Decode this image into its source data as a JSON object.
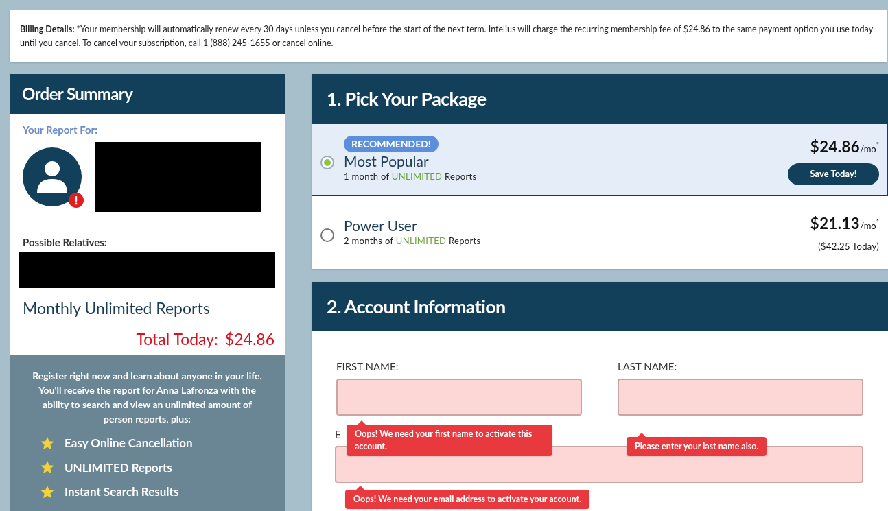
{
  "billing": {
    "text": "**Billing Details:** *Your membership will automatically renew every 30 days unless you cancel before the start of the next term. Intelius will charge the recurring membership fee of $24.86 to the same payment option you use today until you cancel. To cancel your subscription, call 1 (888) 245-1655 or cancel online."
  },
  "order_summary": {
    "title": "Order Summary",
    "report_for_label": "Your Report For:",
    "relatives_label": "Possible Relatives:",
    "plan": "Monthly Unlimited Reports",
    "total_label": "Total Today:",
    "total_value": "$24.86",
    "promo": "Register right now and learn about anyone in your life. You'll receive the report for Anna Lafronza with the ability to search and view an unlimited amount of person reports, plus:",
    "features": [
      "Easy Online Cancellation",
      "UNLIMITED Reports",
      "Instant Search Results"
    ]
  },
  "packages": {
    "title": "1. Pick Your Package",
    "items": [
      {
        "badge": "RECOMMENDED!",
        "name": "Most Popular",
        "description": "1 month of **UNLIMITED** Reports",
        "price": "$24.86",
        "unit": "/mo",
        "mark": "*",
        "button": "Save Today!",
        "selected": true
      },
      {
        "name": "Power User",
        "description": "2 months of **UNLIMITED** Reports",
        "price": "$21.13",
        "unit": "/mo",
        "mark": "*",
        "note": "($42.25 Today)",
        "selected": false
      }
    ]
  },
  "account": {
    "title": "2. Account Information",
    "fields": [
      {
        "label": "FIRST NAME:",
        "error": "Oops! We need your first name to activate this account."
      },
      {
        "label": "LAST NAME:",
        "error": "Please enter your last name also."
      },
      {
        "label": "E",
        "error": "Oops! We need your email address to activate your account."
      }
    ]
  }
}
